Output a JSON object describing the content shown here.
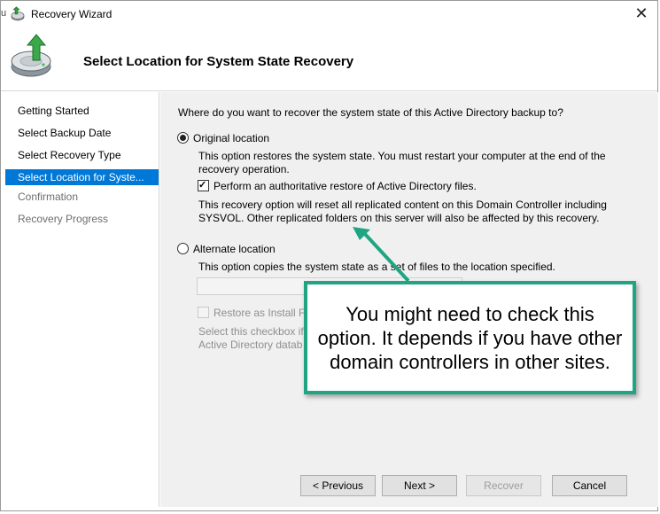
{
  "window": {
    "title": "Recovery Wizard",
    "close_glyph": "✕",
    "left_edge_text": "u"
  },
  "header": {
    "title": "Select Location for System State Recovery",
    "icon": "backup-restore-icon"
  },
  "sidebar": {
    "items": [
      {
        "label": "Getting Started",
        "state": "normal"
      },
      {
        "label": "Select Backup Date",
        "state": "normal"
      },
      {
        "label": "Select Recovery Type",
        "state": "normal"
      },
      {
        "label": "Select Location for Syste...",
        "state": "active"
      },
      {
        "label": "Confirmation",
        "state": "disabled"
      },
      {
        "label": "Recovery Progress",
        "state": "disabled"
      }
    ]
  },
  "main": {
    "question": "Where do you want to recover the system state of this Active Directory backup to?",
    "original": {
      "label": "Original location",
      "selected": true,
      "desc_line1": "This option restores the system state. You must restart your computer at the end of the",
      "desc_line2": "recovery operation.",
      "auth_checkbox": {
        "label": "Perform an authoritative restore of Active Directory files.",
        "checked": true
      },
      "note_line1": "This recovery option will reset all replicated content on this Domain Controller including",
      "note_line2": "SYSVOL. Other replicated folders on this server will also be affected by this recovery."
    },
    "alternate": {
      "label": "Alternate location",
      "selected": false,
      "desc": "This option copies the system state as a set of files to the location specified.",
      "path_value": "",
      "restore_checkbox": {
        "label": "Restore as Install Fr",
        "checked": false
      },
      "hint_line1": "Select this checkbox if",
      "hint_line2": "Active Directory datab"
    }
  },
  "buttons": {
    "previous": "< Previous",
    "next": "Next >",
    "recover": "Recover",
    "cancel": "Cancel"
  },
  "callout": {
    "text": "You might need to check this option. It depends if you have other domain controllers in other sites.",
    "border_color": "#1fa583"
  },
  "colors": {
    "selection": "#0078d7",
    "panel": "#f0f0f0",
    "disabled_text": "#8f8f8f"
  }
}
